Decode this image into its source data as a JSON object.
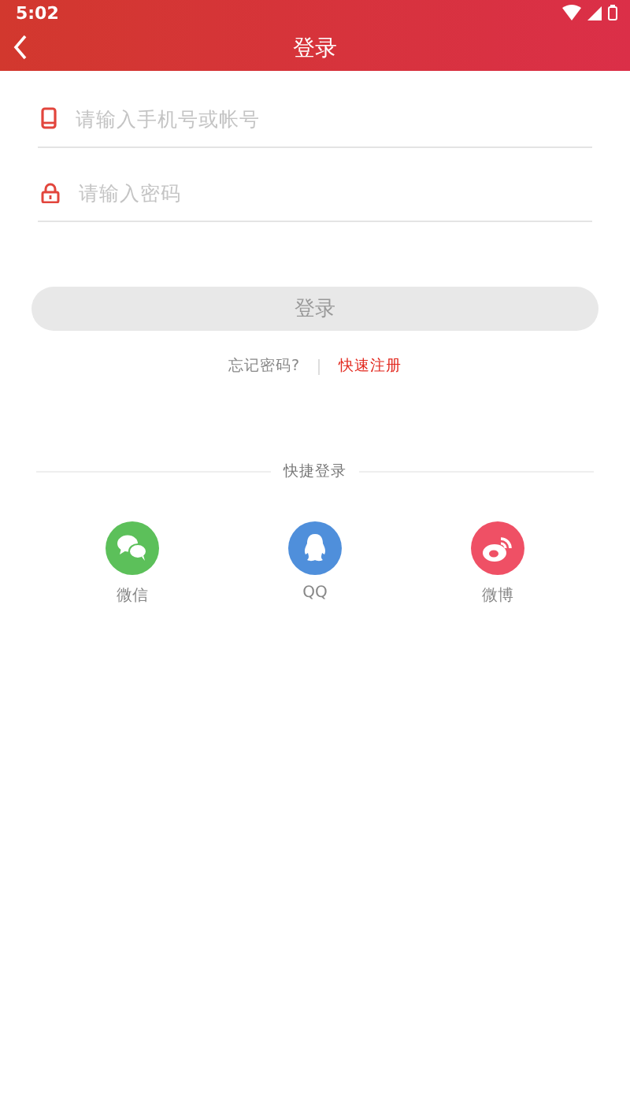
{
  "status_bar": {
    "time": "5:02"
  },
  "header": {
    "title": "登录"
  },
  "fields": [
    {
      "kind": "phone",
      "placeholder": "请输入手机号或帐号"
    },
    {
      "kind": "lock",
      "placeholder": "请输入密码"
    }
  ],
  "login_button": {
    "label": "登录",
    "disabled": true
  },
  "links": {
    "forgot": "忘记密码?",
    "register": "快速注册"
  },
  "quick_login": {
    "title": "快捷登录",
    "items": [
      {
        "kind": "wechat",
        "label": "微信",
        "color": "#5cc05a"
      },
      {
        "kind": "qq",
        "label": "QQ",
        "color": "#4f8fdb"
      },
      {
        "kind": "weibo",
        "label": "微博",
        "color": "#ef5065"
      }
    ]
  }
}
